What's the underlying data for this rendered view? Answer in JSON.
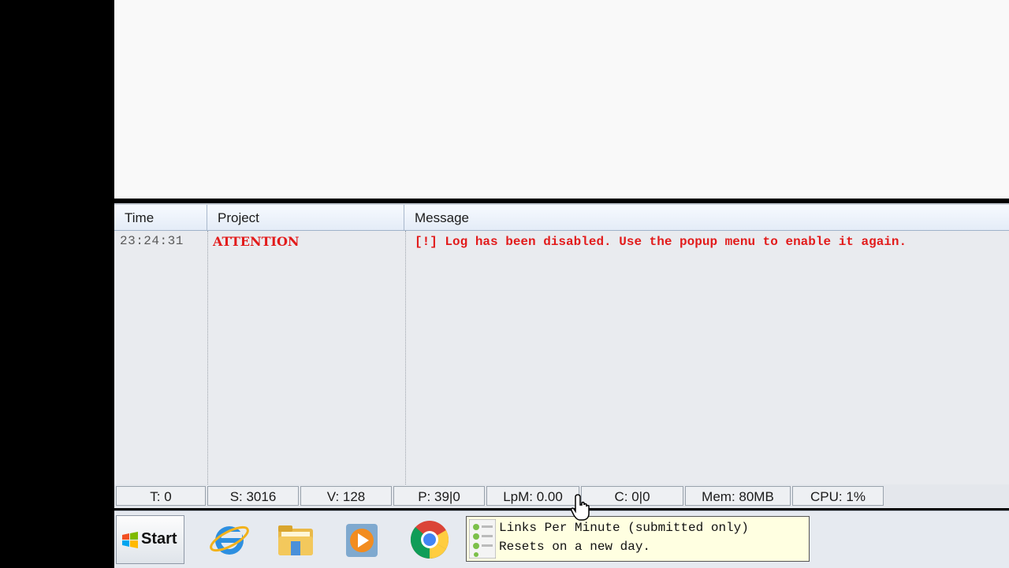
{
  "log": {
    "columns": [
      "Time",
      "Project",
      "Message"
    ],
    "rows": [
      {
        "time": "23:24:31",
        "project": "ATTENTION",
        "message": "[!] Log has been disabled. Use the popup menu to enable it again."
      }
    ]
  },
  "status_bar": {
    "threads": "T: 0",
    "submitted": "S: 3016",
    "verified": "V: 128",
    "proxies": "P: 39|0",
    "lpm": "LpM: 0.00",
    "captcha": "C: 0|0",
    "memory": "Mem: 80MB",
    "cpu": "CPU: 1%"
  },
  "taskbar": {
    "start_label": "Start",
    "icons": [
      "internet-explorer-icon",
      "file-explorer-icon",
      "media-player-icon",
      "chrome-icon"
    ]
  },
  "tooltip": {
    "line1": "Links Per Minute (submitted only)",
    "line2": "Resets on a new day."
  },
  "colors": {
    "attention_red": "#e21b1b",
    "log_bg": "#e9ebef",
    "tooltip_bg": "#ffffe1"
  }
}
